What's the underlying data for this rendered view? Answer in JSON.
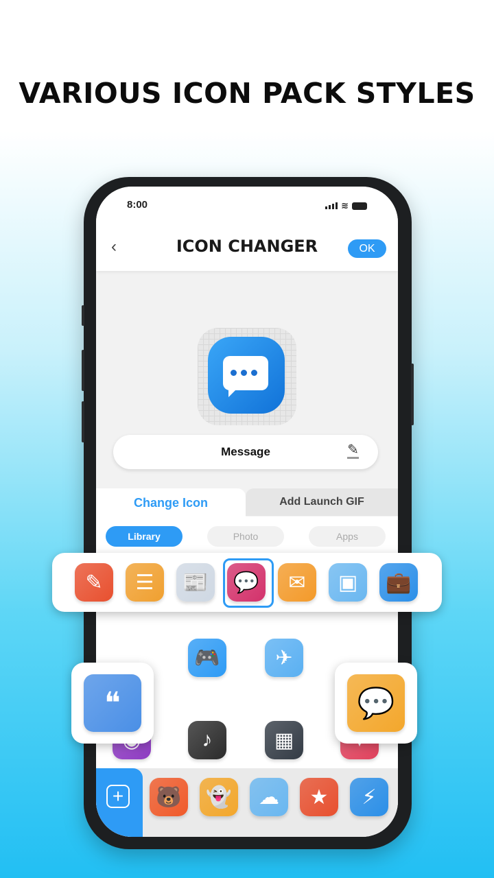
{
  "headline": "VARIOUS ICON PACK STYLES",
  "status": {
    "time": "8:00"
  },
  "header": {
    "back": "‹",
    "title": "ICON CHANGER",
    "ok_label": "OK"
  },
  "app_name": "Message",
  "tabs": [
    {
      "label": "Change Icon",
      "active": true
    },
    {
      "label": "Add Launch GIF",
      "active": false
    }
  ],
  "segments": [
    {
      "label": "Library",
      "active": true
    },
    {
      "label": "Photo",
      "active": false
    },
    {
      "label": "Apps",
      "active": false
    }
  ],
  "accent": "#2e9bf5",
  "strip": [
    {
      "name": "notes-edit",
      "glyph": "✎",
      "color": "#e8502f"
    },
    {
      "name": "documents",
      "glyph": "☰",
      "color": "#f0a030"
    },
    {
      "name": "news",
      "glyph": "📰",
      "color": "#cfd8e3"
    },
    {
      "name": "message-chat",
      "glyph": "💬",
      "color": "#d3326b",
      "selected": true
    },
    {
      "name": "mail",
      "glyph": "✉",
      "color": "#f39a2a"
    },
    {
      "name": "box",
      "glyph": "▣",
      "color": "#6ab7f0"
    },
    {
      "name": "briefcase",
      "glyph": "💼",
      "color": "#2b8fe8"
    }
  ],
  "grid": [
    {
      "name": "documents",
      "glyph": "☰",
      "color": "#f08a28"
    },
    {
      "name": "video-star",
      "glyph": "★",
      "color": "#6d3fc9"
    },
    {
      "name": "notes-edit",
      "glyph": "✎",
      "color": "#e8502f"
    },
    {
      "name": "chart-doc",
      "glyph": "▥",
      "color": "#3aa655"
    },
    {
      "name": "gamepad",
      "glyph": "🎮",
      "color": "#2e9bf5"
    },
    {
      "name": "paper-plane",
      "glyph": "✈",
      "color": "#5ab0f2"
    },
    {
      "name": "podcast",
      "glyph": "◉",
      "color": "#8e3bc2"
    },
    {
      "name": "music-disc",
      "glyph": "♪",
      "color": "#2b2b2b"
    },
    {
      "name": "piano",
      "glyph": "▦",
      "color": "#333b45"
    },
    {
      "name": "heart-drop",
      "glyph": "♥",
      "color": "#e0425d"
    }
  ],
  "cards": [
    {
      "name": "document-quote",
      "glyph": "❝",
      "color": "#4a8fe6"
    },
    {
      "name": "chat-bubbles",
      "glyph": "💬",
      "color": "#f3a72c"
    }
  ],
  "dock": [
    {
      "name": "bear-chat",
      "glyph": "🐻",
      "color": "#f05a2a"
    },
    {
      "name": "ghost",
      "glyph": "👻",
      "color": "#f3a72c"
    },
    {
      "name": "cloud-upload",
      "glyph": "☁",
      "color": "#6ab7f0"
    },
    {
      "name": "notes-star",
      "glyph": "★",
      "color": "#e8502f"
    },
    {
      "name": "lightning",
      "glyph": "⚡",
      "color": "#2b8fe8"
    }
  ]
}
